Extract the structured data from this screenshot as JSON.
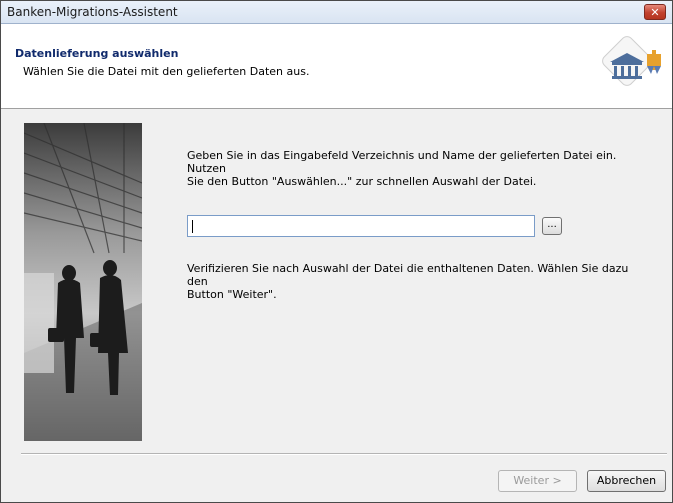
{
  "window": {
    "title": "Banken-Migrations-Assistent",
    "close_label": "✕"
  },
  "header": {
    "title": "Datenlieferung auswählen",
    "subtitle": "Wählen Sie die Datei mit den gelieferten Daten aus."
  },
  "main": {
    "intro_line1": "Geben Sie in das Eingabefeld Verzeichnis und Name der gelieferten Datei ein. Nutzen",
    "intro_line2": "Sie den Button \"Auswählen...\" zur schnellen Auswahl der Datei.",
    "file_input_value": "",
    "browse_label": "...",
    "verify_line1": "Verifizieren Sie nach Auswahl der Datei die enthaltenen Daten. Wählen Sie dazu den",
    "verify_line2": "Button \"Weiter\"."
  },
  "footer": {
    "next_label": "Weiter >",
    "cancel_label": "Abbrechen"
  }
}
